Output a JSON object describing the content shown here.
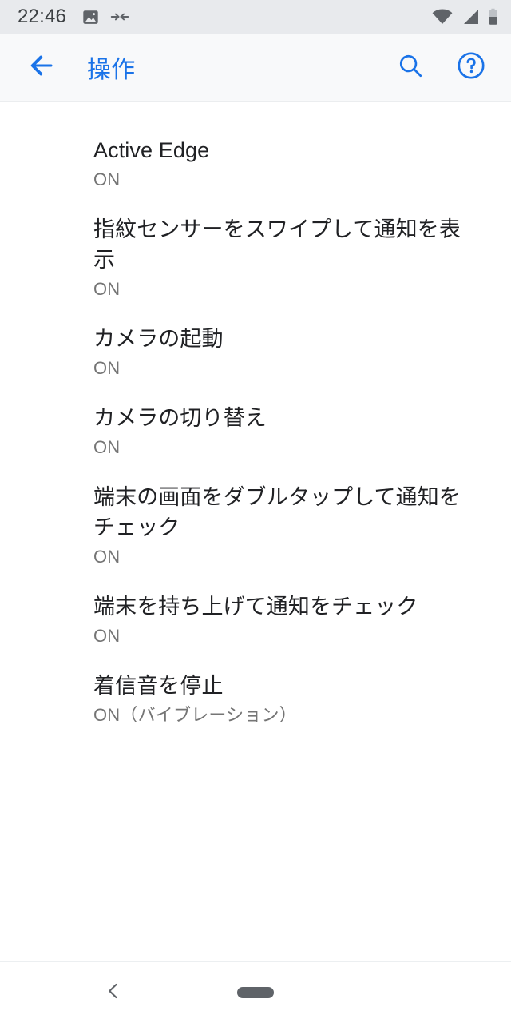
{
  "status_bar": {
    "time": "22:46",
    "left_icons": [
      "screenshot-image-icon",
      "collapse-arrows-icon"
    ],
    "right_icons": [
      "wifi-icon",
      "cellular-signal-icon",
      "battery-icon"
    ],
    "background_color": "#E8EAED",
    "foreground_color": "#5F6368"
  },
  "app_bar": {
    "title": "操作",
    "back_icon": "arrow-left-icon",
    "search_icon": "search-icon",
    "help_icon": "help-circle-icon",
    "accent_color": "#1A73E8",
    "background_color": "#F8F9FA"
  },
  "preferences": [
    {
      "title": "Active Edge",
      "summary": "ON"
    },
    {
      "title": "指紋センサーをスワイプして通知を表示",
      "summary": "ON"
    },
    {
      "title": "カメラの起動",
      "summary": "ON"
    },
    {
      "title": "カメラの切り替え",
      "summary": "ON"
    },
    {
      "title": "端末の画面をダブルタップして通知をチェック",
      "summary": "ON"
    },
    {
      "title": "端末を持ち上げて通知をチェック",
      "summary": "ON"
    },
    {
      "title": "着信音を停止",
      "summary": "ON（バイブレーション）"
    }
  ],
  "nav_bar": {
    "back_icon": "chevron-left-icon",
    "home_pill": "home-pill-indicator",
    "color": "#5F6368"
  }
}
